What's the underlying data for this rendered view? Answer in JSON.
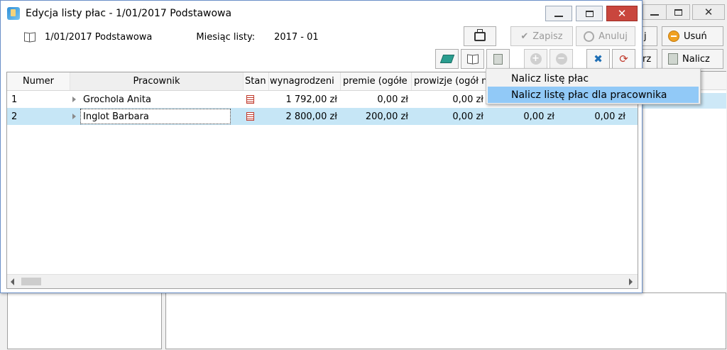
{
  "parent_window": {
    "buttons": {
      "partial_left": "j",
      "delete": "Usuń",
      "partial_left2": "rz",
      "calculate": "Nalicz"
    }
  },
  "window": {
    "title": "Edycja listy płac - 1/01/2017  Podstawowa",
    "info": {
      "date_type": "1/01/2017  Podstawowa",
      "month_label": "Miesiąc listy:",
      "month_value": "2017 - 01"
    },
    "toolbar": {
      "save_label": "Zapisz",
      "cancel_label": "Anuluj"
    }
  },
  "grid": {
    "columns": [
      "Numer",
      "Pracownik",
      "Stan",
      "wynagrodzeni",
      "premie (ogółe",
      "prowizje (ogół n"
    ],
    "rows": [
      {
        "numer": "1",
        "pracownik": "Grochola Anita",
        "wynagrodzenie": "1 792,00 zł",
        "premie": "0,00 zł",
        "prowizje": "0,00 zł",
        "extra1": "",
        "extra2": ""
      },
      {
        "numer": "2",
        "pracownik": "Inglot Barbara",
        "wynagrodzenie": "2 800,00 zł",
        "premie": "200,00 zł",
        "prowizje": "0,00 zł",
        "extra1": "0,00 zł",
        "extra2": "0,00 zł"
      }
    ],
    "selected_row": 2
  },
  "context_menu": {
    "items": [
      "Nalicz listę płac",
      "Nalicz listę płac dla pracownika"
    ]
  },
  "colors": {
    "selection": "#c6e6f6",
    "menu_hover": "#91c9f7",
    "close_button": "#c9463d"
  }
}
